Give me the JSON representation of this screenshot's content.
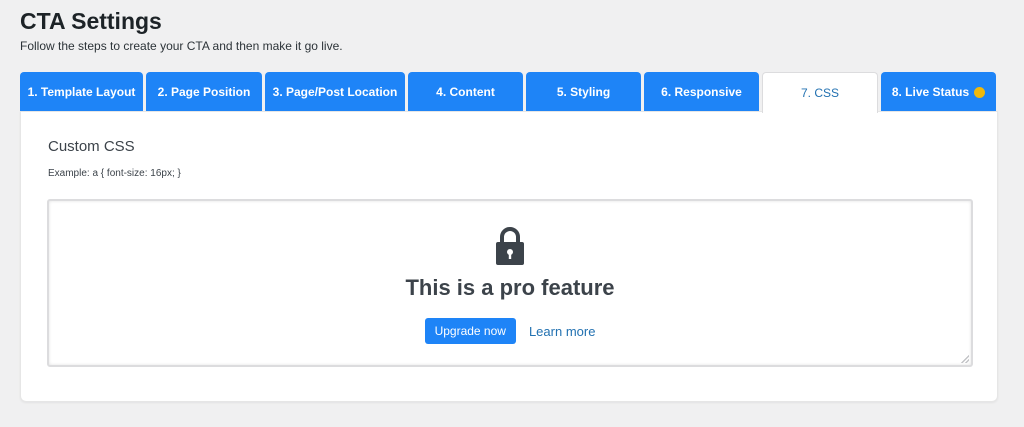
{
  "header": {
    "title": "CTA Settings",
    "subtitle": "Follow the steps to create your CTA and then make it go live."
  },
  "tabs": [
    {
      "label": "1. Template Layout",
      "active": false
    },
    {
      "label": "2. Page Position",
      "active": false
    },
    {
      "label": "3. Page/Post Location",
      "active": false
    },
    {
      "label": "4. Content",
      "active": false
    },
    {
      "label": "5. Styling",
      "active": false
    },
    {
      "label": "6. Responsive",
      "active": false
    },
    {
      "label": "7. CSS",
      "active": true
    },
    {
      "label": "8. Live Status",
      "active": false,
      "status_color": "#f0b90b"
    }
  ],
  "css_section": {
    "title": "Custom CSS",
    "example": "Example: a { font-size: 16px; }",
    "lock_icon": "lock-icon",
    "pro_message": "This is a pro feature",
    "upgrade_label": "Upgrade now",
    "learn_more_label": "Learn more"
  },
  "colors": {
    "accent": "#1e84f7",
    "link": "#2271b1",
    "status_dot": "#f0b90b"
  }
}
